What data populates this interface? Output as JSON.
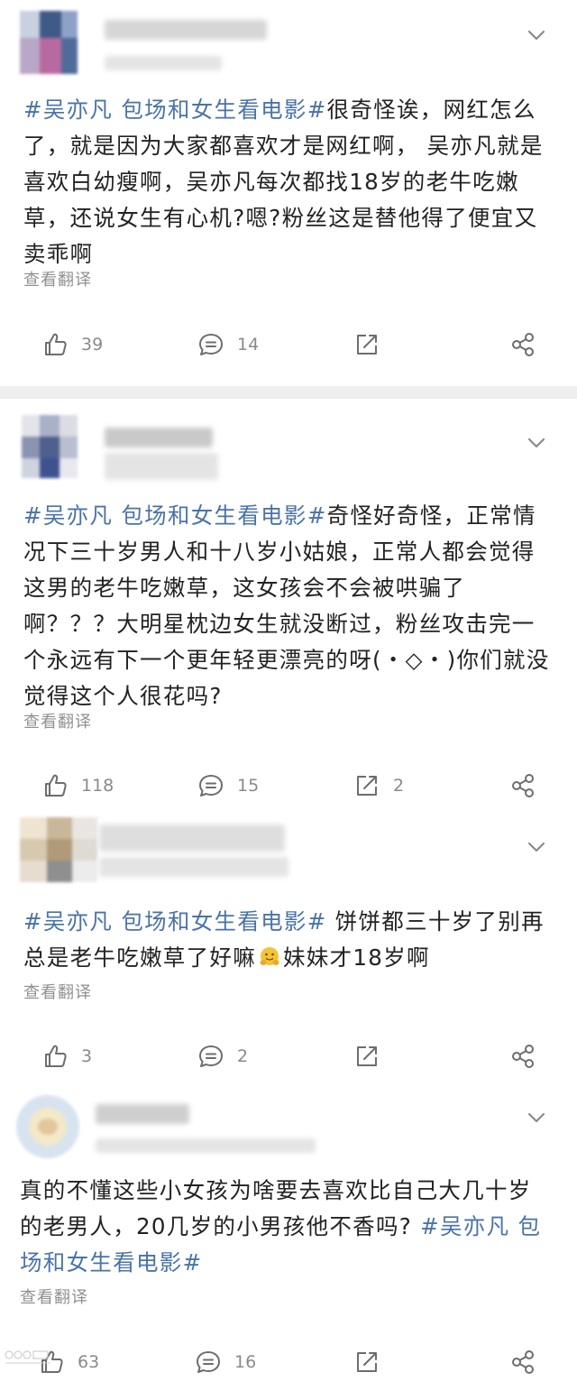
{
  "posts": [
    {
      "hashtag": "#吴亦凡 包场和女生看电影#",
      "body": "很奇怪诶，网红怎么了，就是因为大家都喜欢才是网红啊， 吴亦凡就是喜欢白幼瘦啊，吴亦凡每次都找18岁的老牛吃嫩草，还说女生有心机?嗯?粉丝这是替他得了便宜又卖乖啊",
      "translate": "查看翻译",
      "likes": "39",
      "comments": "14",
      "reposts": ""
    },
    {
      "hashtag": "#吴亦凡 包场和女生看电影#",
      "body": "奇怪好奇怪，正常情况下三十岁男人和十八岁小姑娘，正常人都会觉得这男的老牛吃嫩草，这女孩会不会被哄骗了啊？？？大明星枕边女生就没断过，粉丝攻击完一个永远有下一个更年轻更漂亮的呀(・◇・)你们就没觉得这个人很花吗?",
      "translate": "查看翻译",
      "likes": "118",
      "comments": "15",
      "reposts": "2"
    },
    {
      "hashtag": "#吴亦凡 包场和女生看电影#",
      "body_before_emoji": " 饼饼都三十岁了别再总是老牛吃嫩草了好嘛",
      "body_after_emoji": "妹妹才18岁啊",
      "translate": "查看翻译",
      "likes": "3",
      "comments": "2",
      "reposts": ""
    },
    {
      "body": "真的不懂这些小女孩为啥要去喜欢比自己大几十岁的老男人，20几岁的小男孩他不香吗? ",
      "hashtag": "#吴亦凡 包场和女生看电影#",
      "translate": "查看翻译",
      "likes": "63",
      "comments": "16",
      "reposts": ""
    }
  ],
  "icons": {
    "like": "thumbs-up-icon",
    "comment": "comment-icon",
    "repost": "repost-icon",
    "share": "share-icon",
    "menu": "chevron-down-icon"
  },
  "colors": {
    "hashtag": "#4a73a8",
    "text": "#222222",
    "muted": "#909090",
    "icon": "#6d6d6d",
    "separator": "#eeeeee"
  }
}
